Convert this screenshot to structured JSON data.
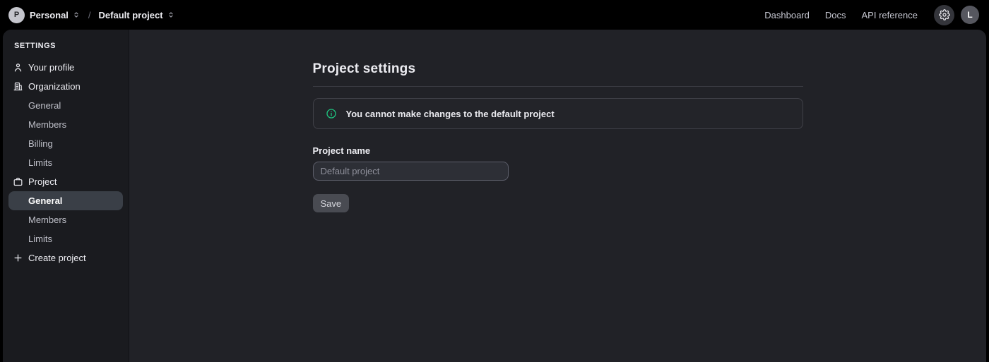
{
  "topbar": {
    "org_avatar_initial": "P",
    "org_name": "Personal",
    "separator": "/",
    "project_name": "Default project",
    "nav_links": [
      {
        "label": "Dashboard"
      },
      {
        "label": "Docs"
      },
      {
        "label": "API reference"
      }
    ],
    "user_avatar_initial": "L"
  },
  "sidebar": {
    "heading": "SETTINGS",
    "items": [
      {
        "label": "Your profile",
        "icon": "person-icon"
      },
      {
        "label": "Organization",
        "icon": "building-icon"
      },
      {
        "label": "General"
      },
      {
        "label": "Members"
      },
      {
        "label": "Billing"
      },
      {
        "label": "Limits"
      },
      {
        "label": "Project",
        "icon": "briefcase-icon"
      },
      {
        "label": "General",
        "selected": true
      },
      {
        "label": "Members"
      },
      {
        "label": "Limits"
      },
      {
        "label": "Create project",
        "icon": "plus-icon"
      }
    ]
  },
  "main": {
    "title": "Project settings",
    "banner": {
      "icon": "info-circle-icon",
      "message": "You cannot make changes to the default project"
    },
    "form": {
      "name_label": "Project name",
      "name_placeholder": "Default project",
      "save_label": "Save"
    }
  },
  "colors": {
    "topbar_bg": "#000000",
    "sidebar_bg": "#1a1b1f",
    "main_bg": "#212227",
    "selected_item_bg": "#3a3f47",
    "accent_green": "#1fc37f"
  }
}
